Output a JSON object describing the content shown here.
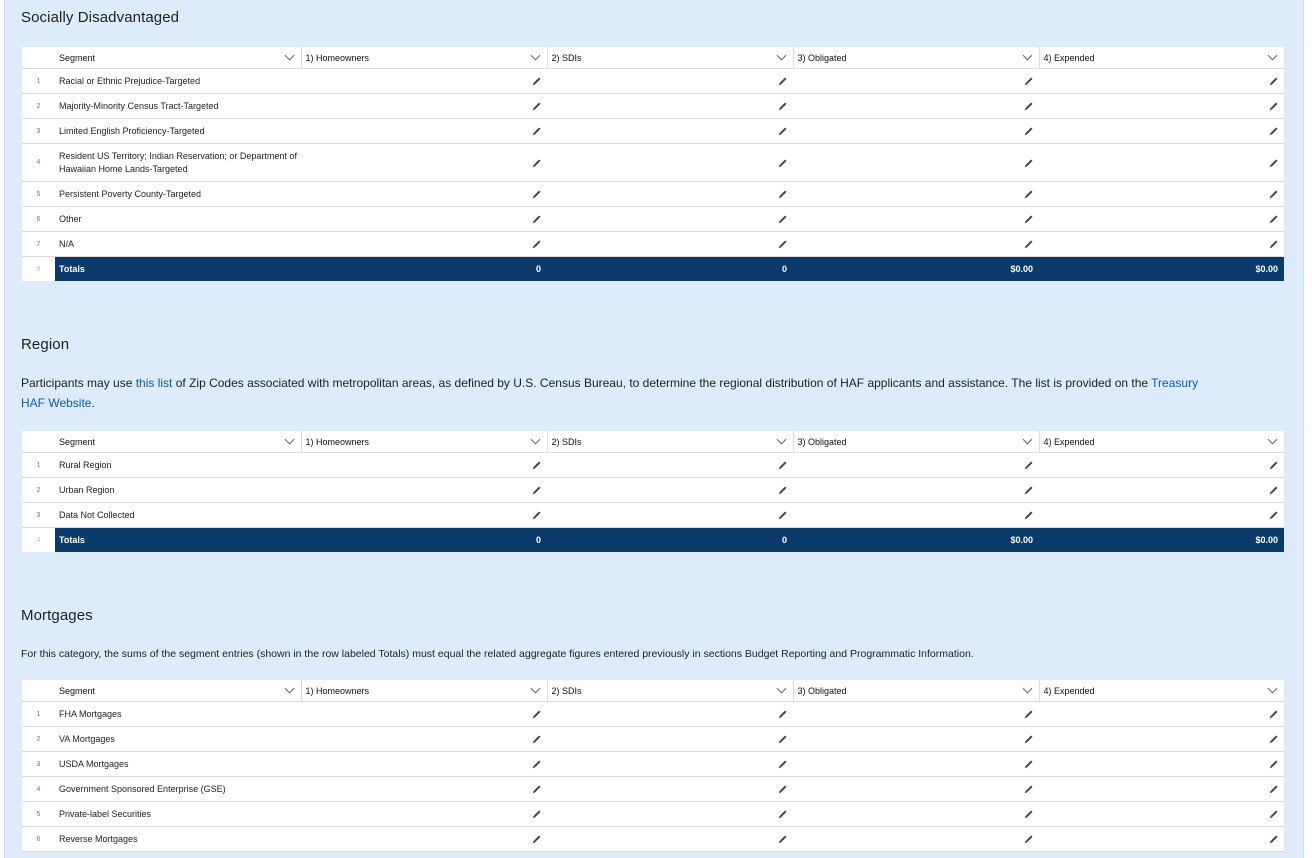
{
  "columns": {
    "segment": "Segment",
    "homeowners": "1) Homeowners",
    "sdis": "2) SDIs",
    "obligated": "3) Obligated",
    "expended": "4) Expended"
  },
  "sections": {
    "disadvantaged": {
      "title": "Socially Disadvantaged",
      "rows": [
        {
          "num": "1",
          "segment": "Racial or Ethnic Prejudice-Targeted"
        },
        {
          "num": "2",
          "segment": "Majority-Minority Census Tract-Targeted"
        },
        {
          "num": "3",
          "segment": "Limited English Proficiency-Targeted"
        },
        {
          "num": "4",
          "segment": "Resident US Territory; Indian Reservation; or Department of Hawaiian Home Lands-Targeted"
        },
        {
          "num": "5",
          "segment": "Persistent Poverty County-Targeted"
        },
        {
          "num": "6",
          "segment": "Other"
        },
        {
          "num": "7",
          "segment": "N/A"
        }
      ],
      "totals": {
        "num": "8",
        "label": "Totals",
        "homeowners": "0",
        "sdis": "0",
        "obligated": "$0.00",
        "expended": "$0.00"
      }
    },
    "region": {
      "title": "Region",
      "desc_before": "Participants may use ",
      "link1": "this list",
      "desc_middle": " of Zip Codes associated with metropolitan areas, as defined by U.S. Census Bureau, to determine the regional distribution of HAF applicants and assistance. The list is provided on the ",
      "link2": "Treasury HAF Website",
      "desc_after": ".",
      "rows": [
        {
          "num": "1",
          "segment": "Rural Region"
        },
        {
          "num": "2",
          "segment": "Urban Region"
        },
        {
          "num": "3",
          "segment": "Data Not Collected"
        }
      ],
      "totals": {
        "num": "4",
        "label": "Totals",
        "homeowners": "0",
        "sdis": "0",
        "obligated": "$0.00",
        "expended": "$0.00"
      }
    },
    "mortgages": {
      "title": "Mortgages",
      "desc": "For this category, the sums of the segment entries (shown in the row labeled Totals) must equal the related aggregate figures entered previously in sections Budget Reporting and Programmatic Information.",
      "rows": [
        {
          "num": "1",
          "segment": "FHA Mortgages"
        },
        {
          "num": "2",
          "segment": "VA Mortgages"
        },
        {
          "num": "3",
          "segment": "USDA Mortgages"
        },
        {
          "num": "4",
          "segment": "Government Sponsored Enterprise (GSE)"
        },
        {
          "num": "5",
          "segment": "Private-label Securities"
        },
        {
          "num": "6",
          "segment": "Reverse Mortgages"
        }
      ]
    }
  },
  "icons": {
    "header_chevron": "chevron-down-icon",
    "cell_edit": "pencil-icon"
  },
  "colors": {
    "panel_bg": "#deebfb",
    "totals_bg": "#0b3a6b",
    "link": "#0b5cab"
  }
}
